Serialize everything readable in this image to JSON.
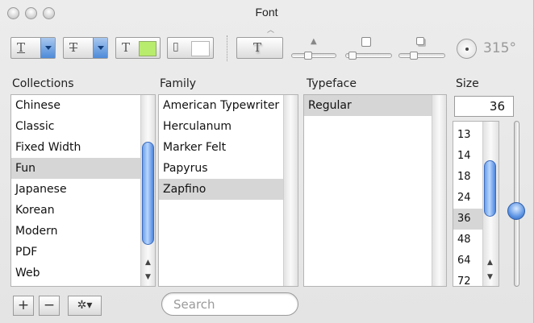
{
  "window": {
    "title": "Font"
  },
  "toolbar": {
    "underline_glyph": "T",
    "strike_glyph": "T",
    "text_color_glyph": "T",
    "document_color_glyph": "▯",
    "shadow_glyph": "T",
    "angle": "315°",
    "colors": {
      "text_color": "#b8ec6c",
      "document_color": "#ffffff"
    }
  },
  "columns": {
    "collections": "Collections",
    "family": "Family",
    "typeface": "Typeface",
    "size": "Size"
  },
  "collections": {
    "items": [
      "Chinese",
      "Classic",
      "Fixed Width",
      "Fun",
      "Japanese",
      "Korean",
      "Modern",
      "PDF",
      "Web"
    ],
    "selected": "Fun"
  },
  "family": {
    "items": [
      "American Typewriter",
      "Herculanum",
      "Marker Felt",
      "Papyrus",
      "Zapfino"
    ],
    "selected": "Zapfino"
  },
  "typeface": {
    "items": [
      "Regular"
    ],
    "selected": "Regular"
  },
  "size": {
    "value": "36",
    "items": [
      "13",
      "14",
      "18",
      "24",
      "36",
      "48",
      "64",
      "72"
    ],
    "selected": "36"
  },
  "bottom": {
    "add_label": "+",
    "remove_label": "−",
    "action_label": "✲▾",
    "search_placeholder": "Search"
  },
  "theme": {
    "selection": "#d6d6d6",
    "accent": "#4d8ad8"
  }
}
